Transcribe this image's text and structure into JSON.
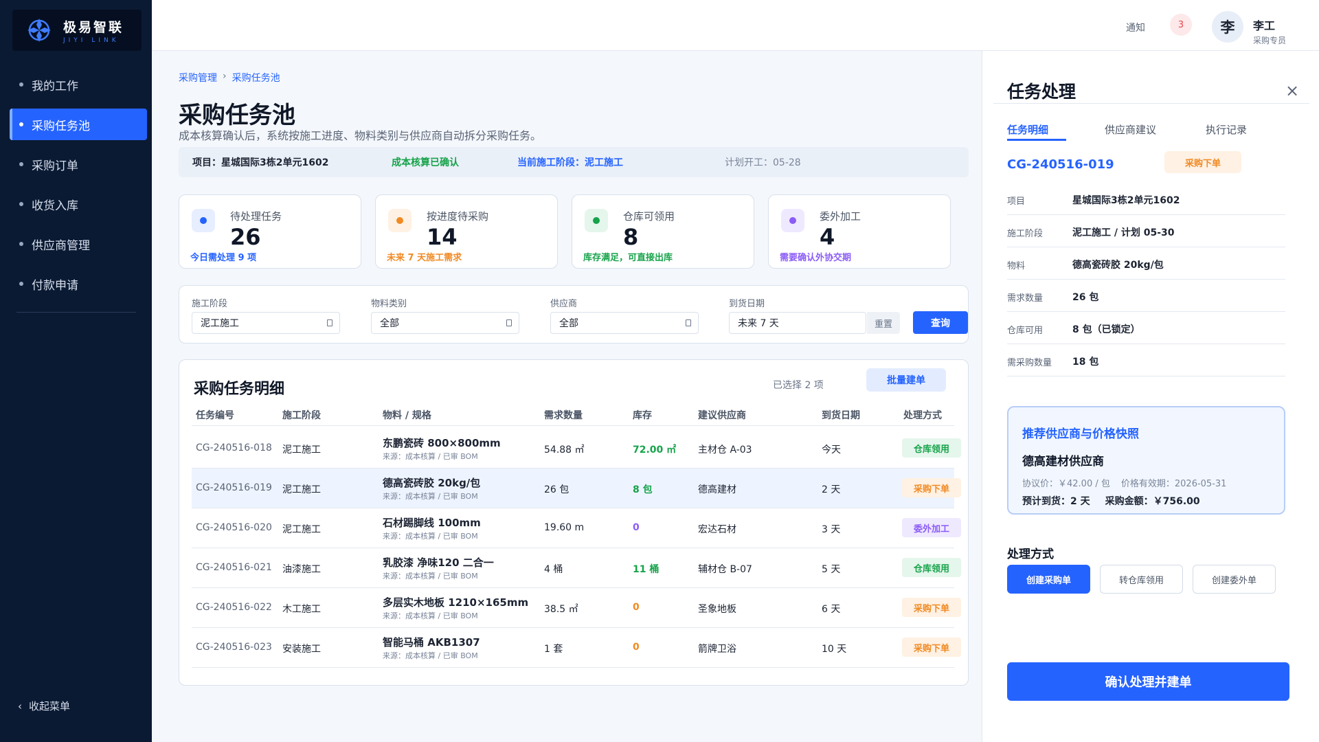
{
  "brand": {
    "name_cn": "极易智联",
    "name_en": "JIYI LINK"
  },
  "sidebar": {
    "items": [
      {
        "label": "我的工作"
      },
      {
        "label": "采购任务池"
      },
      {
        "label": "采购订单"
      },
      {
        "label": "收货入库"
      },
      {
        "label": "供应商管理"
      },
      {
        "label": "付款申请"
      }
    ],
    "collapse_label": "收起菜单"
  },
  "topbar": {
    "notice_label": "通知",
    "notice_count": "3",
    "avatar_char": "李",
    "user_name": "李工",
    "user_role": "采购专员"
  },
  "breadcrumb": {
    "root": "采购管理",
    "sep": "›",
    "current": "采购任务池"
  },
  "page": {
    "title": "采购任务池",
    "subtitle": "成本核算确认后，系统按施工进度、物料类别与供应商自动拆分采购任务。"
  },
  "info_bar": {
    "project": "项目：星城国际3栋2单元1602",
    "cost_status": "成本核算已确认",
    "stage": "当前施工阶段：泥工施工",
    "plan_start": "计划开工：05-28"
  },
  "stats": [
    {
      "label": "待处理任务",
      "value": "26",
      "hint": "今日需处理 9 项",
      "color": "#2563ff",
      "bg": "#e6eeff"
    },
    {
      "label": "按进度待采购",
      "value": "14",
      "hint": "未来 7 天施工需求",
      "color": "#f08a24",
      "bg": "#fff1e3"
    },
    {
      "label": "仓库可领用",
      "value": "8",
      "hint": "库存满足，可直接出库",
      "color": "#16a34a",
      "bg": "#e5f6ec"
    },
    {
      "label": "委外加工",
      "value": "4",
      "hint": "需要确认外协交期",
      "color": "#8b5cf6",
      "bg": "#efe9ff"
    }
  ],
  "filters": {
    "stage": {
      "label": "施工阶段",
      "value": "泥工施工"
    },
    "category": {
      "label": "物料类别",
      "value": "全部"
    },
    "supplier": {
      "label": "供应商",
      "value": "全部"
    },
    "date": {
      "label": "到货日期",
      "value": "未来 7 天"
    },
    "reset_label": "重置",
    "query_label": "查询"
  },
  "table": {
    "title": "采购任务明细",
    "selected_text": "已选择 2 项",
    "batch_label": "批量建单",
    "headers": [
      "任务编号",
      "施工阶段",
      "物料 / 规格",
      "需求数量",
      "库存",
      "建议供应商",
      "到货日期",
      "处理方式"
    ],
    "rows": [
      {
        "id": "CG-240516-018",
        "stage": "泥工施工",
        "material": "东鹏瓷砖 800×800mm",
        "source": "来源：成本核算 / 已审 BOM",
        "qty": "54.88 ㎡",
        "stock": "72.00 ㎡",
        "stock_color": "#16a34a",
        "supplier": "主材仓 A-03",
        "date": "今天",
        "action": "仓库领用",
        "action_color": "#16a34a",
        "action_bg": "#e5f6ec"
      },
      {
        "id": "CG-240516-019",
        "stage": "泥工施工",
        "material": "德高瓷砖胶 20kg/包",
        "source": "来源：成本核算 / 已审 BOM",
        "qty": "26 包",
        "stock": "8 包",
        "stock_color": "#16a34a",
        "supplier": "德高建材",
        "date": "2 天",
        "action": "采购下单",
        "action_color": "#f08a24",
        "action_bg": "#fff1e3"
      },
      {
        "id": "CG-240516-020",
        "stage": "泥工施工",
        "material": "石材踢脚线 100mm",
        "source": "来源：成本核算 / 已审 BOM",
        "qty": "19.60 m",
        "stock": "0",
        "stock_color": "#8b5cf6",
        "supplier": "宏达石材",
        "date": "3 天",
        "action": "委外加工",
        "action_color": "#8b5cf6",
        "action_bg": "#efe9ff"
      },
      {
        "id": "CG-240516-021",
        "stage": "油漆施工",
        "material": "乳胶漆 净味120 二合一",
        "source": "来源：成本核算 / 已审 BOM",
        "qty": "4 桶",
        "stock": "11 桶",
        "stock_color": "#16a34a",
        "supplier": "辅材仓 B-07",
        "date": "5 天",
        "action": "仓库领用",
        "action_color": "#16a34a",
        "action_bg": "#e5f6ec"
      },
      {
        "id": "CG-240516-022",
        "stage": "木工施工",
        "material": "多层实木地板 1210×165mm",
        "source": "来源：成本核算 / 已审 BOM",
        "qty": "38.5 ㎡",
        "stock": "0",
        "stock_color": "#f08a24",
        "supplier": "圣象地板",
        "date": "6 天",
        "action": "采购下单",
        "action_color": "#f08a24",
        "action_bg": "#fff1e3"
      },
      {
        "id": "CG-240516-023",
        "stage": "安装施工",
        "material": "智能马桶 AKB1307",
        "source": "来源：成本核算 / 已审 BOM",
        "qty": "1 套",
        "stock": "0",
        "stock_color": "#f08a24",
        "supplier": "箭牌卫浴",
        "date": "10 天",
        "action": "采购下单",
        "action_color": "#f08a24",
        "action_bg": "#fff1e3"
      }
    ]
  },
  "panel": {
    "title": "任务处理",
    "close": "×",
    "tabs": [
      "任务明细",
      "供应商建议",
      "执行记录"
    ],
    "code": "CG-240516-019",
    "status": "采购下单",
    "details": [
      {
        "k": "项目",
        "v": "星城国际3栋2单元1602"
      },
      {
        "k": "施工阶段",
        "v": "泥工施工 / 计划 05-30"
      },
      {
        "k": "物料",
        "v": "德高瓷砖胶 20kg/包"
      },
      {
        "k": "需求数量",
        "v": "26 包"
      },
      {
        "k": "仓库可用",
        "v": "8 包（已锁定）"
      },
      {
        "k": "需采购数量",
        "v": "18 包"
      }
    ],
    "recommend": {
      "title": "推荐供应商与价格快照",
      "supplier": "德高建材供应商",
      "price": "协议价：￥42.00 / 包",
      "valid": "价格有效期：2026-05-31",
      "eta": "预计到货：2 天",
      "amount": "采购金额：￥756.00"
    },
    "method_title": "处理方式",
    "methods": [
      "创建采购单",
      "转仓库领用",
      "创建委外单"
    ],
    "confirm_label": "确认处理并建单"
  }
}
